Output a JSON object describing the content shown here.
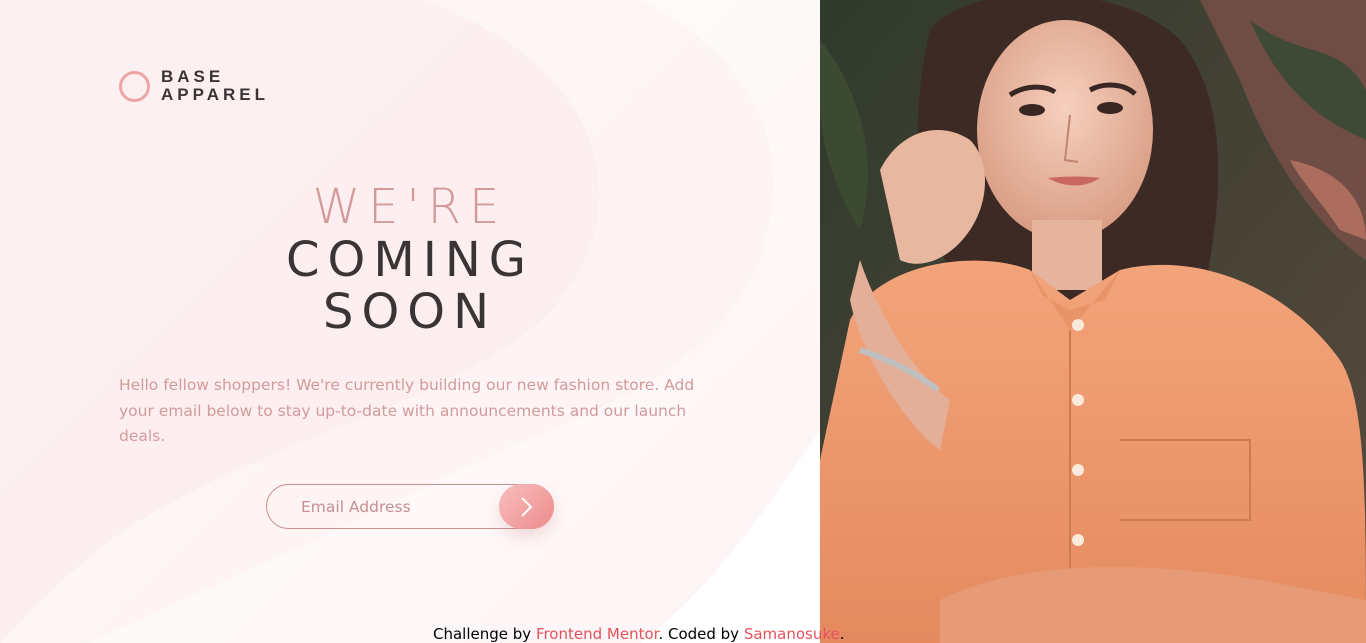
{
  "brand": {
    "line1": "BASE",
    "line2": "APPAREL",
    "accent_color": "#f0a5a5"
  },
  "hero": {
    "light_word": "WE'RE",
    "dark_line1": "COMING",
    "dark_line2": "SOON",
    "description": "Hello fellow shoppers! We're currently building our new fashion store. Add your email below to stay up-to-date with announcements and our launch deals."
  },
  "form": {
    "email_placeholder": "Email Address",
    "email_value": "",
    "submit_icon": "chevron-right-icon"
  },
  "image": {
    "alt": "woman-in-orange-shirt-photo"
  },
  "footer": {
    "prefix": "Challenge by ",
    "link1": "Frontend Mentor",
    "middle": ". Coded by ",
    "link2": "Samanosuke",
    "suffix": "."
  },
  "colors": {
    "text_dark": "#3b3436",
    "text_pink": "#d29b9b",
    "link": "#e5525c"
  }
}
